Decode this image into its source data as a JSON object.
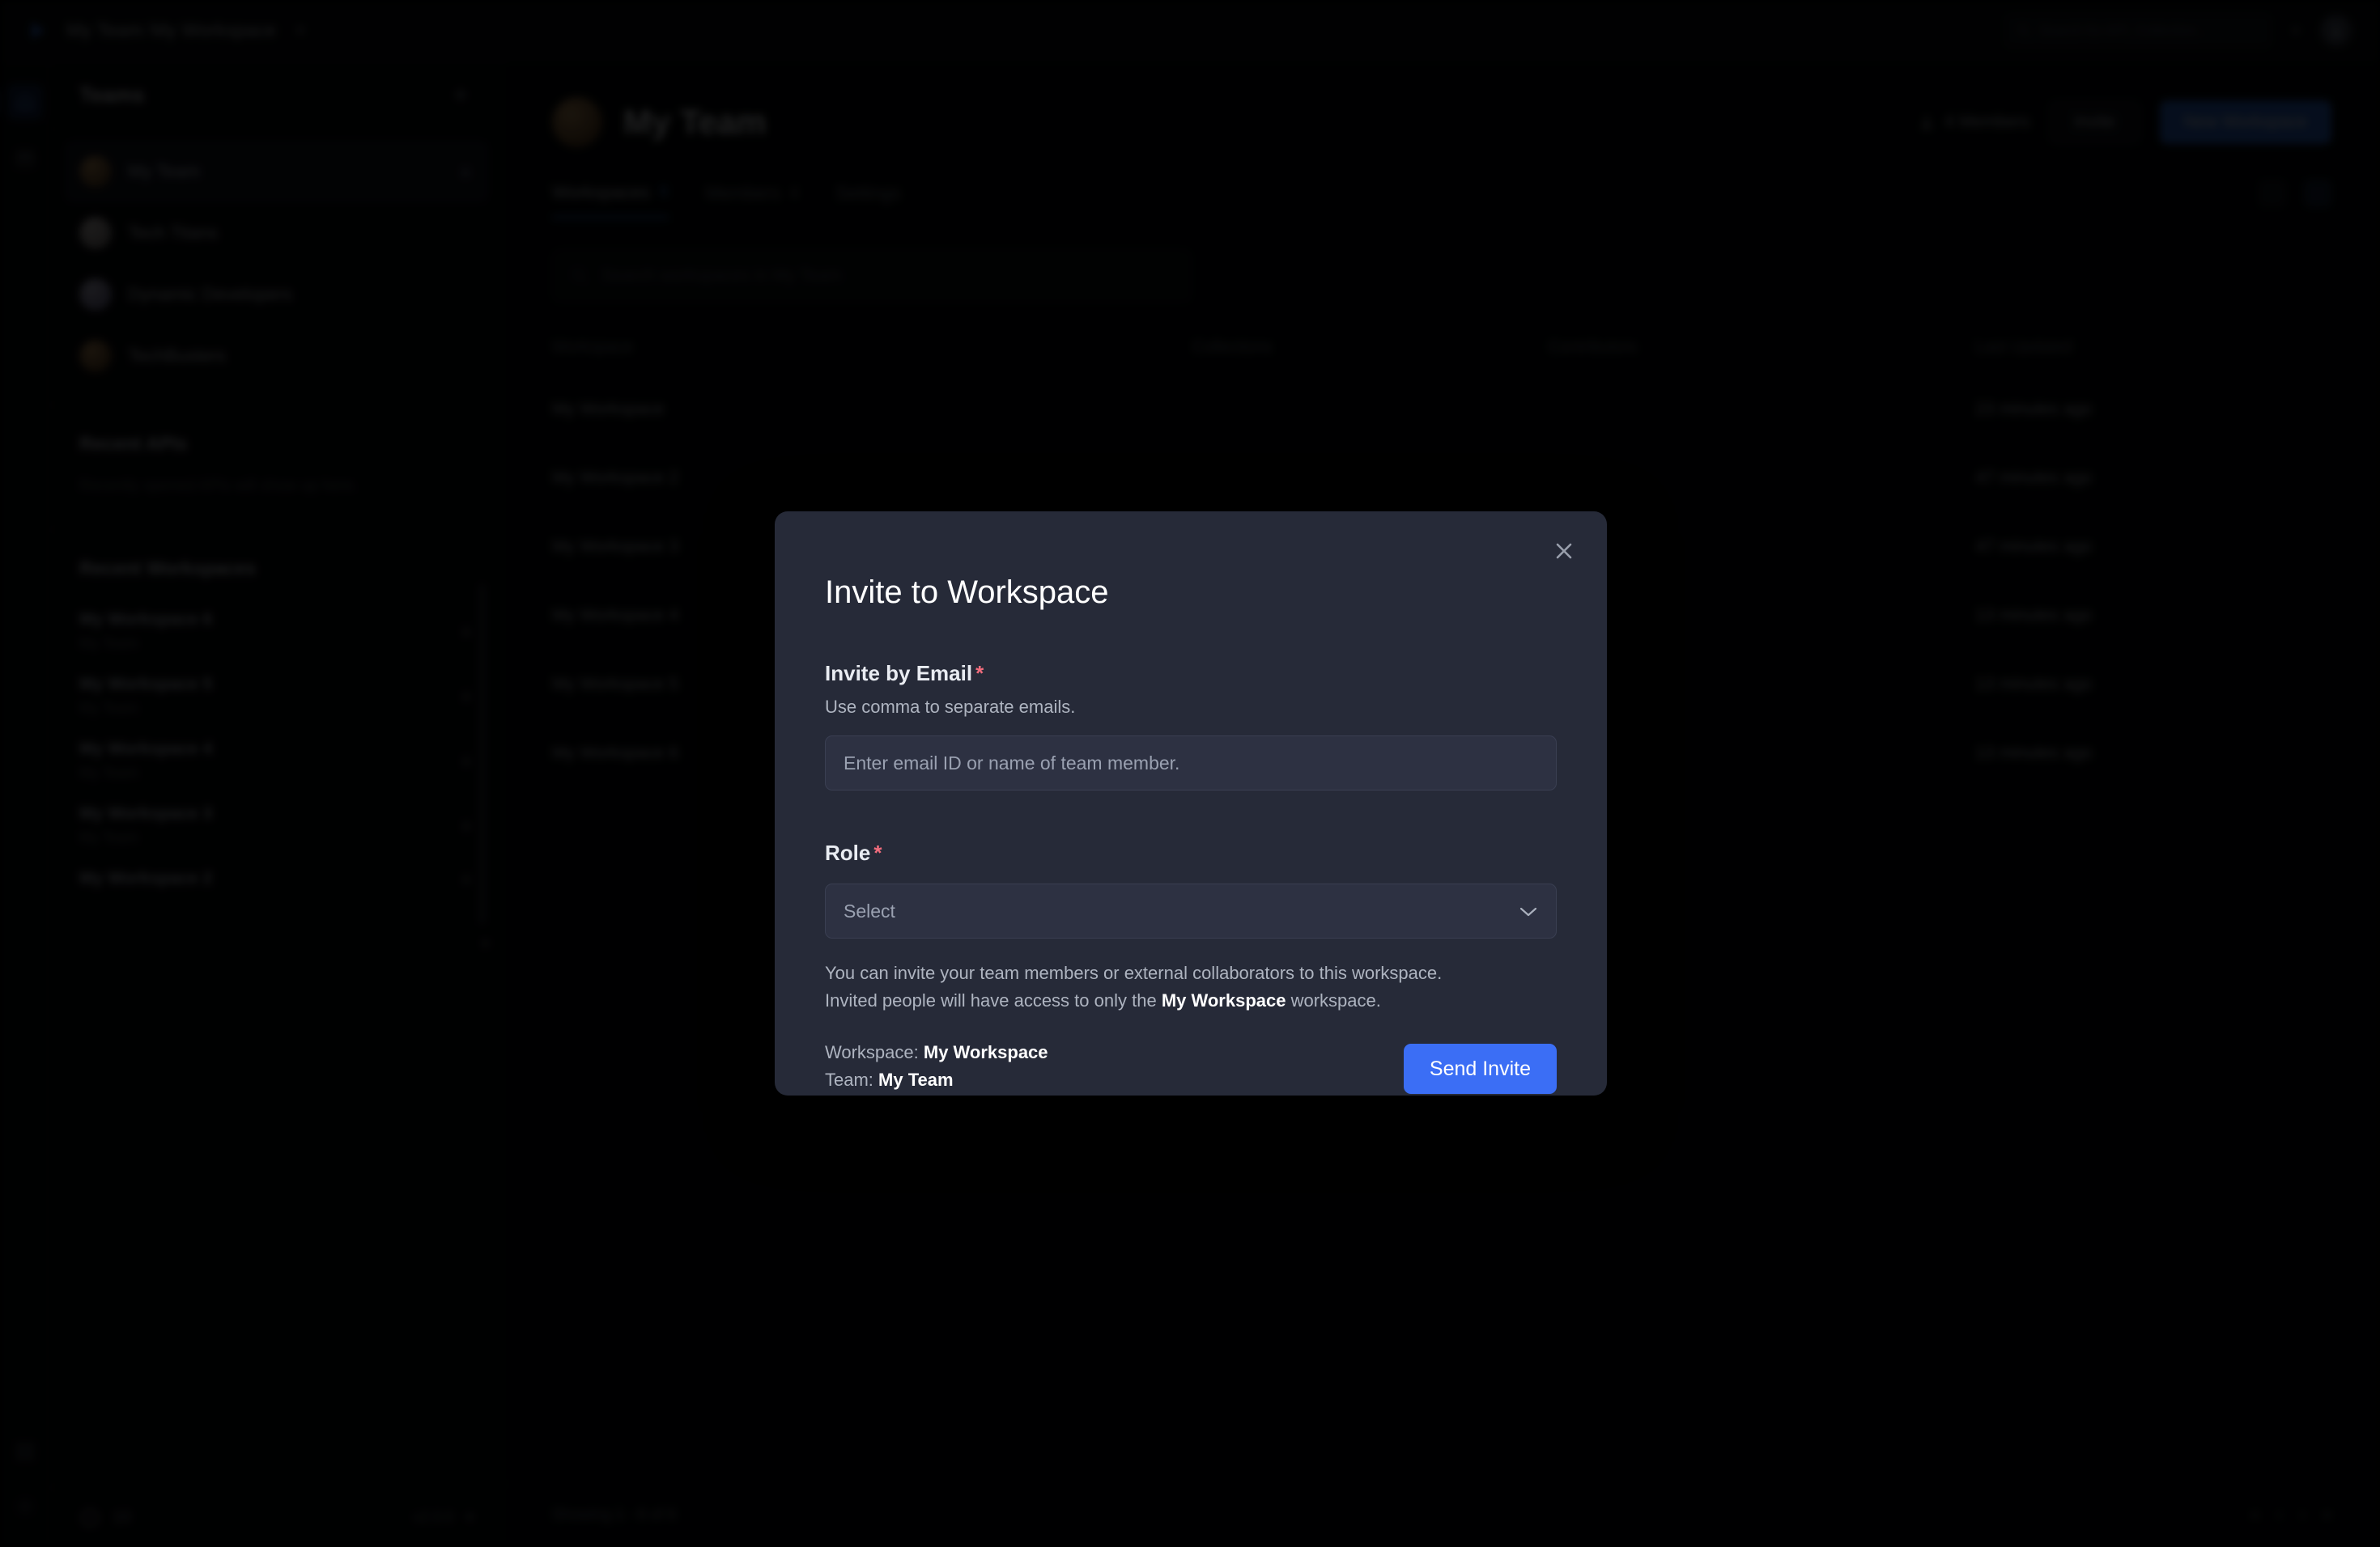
{
  "topbar": {
    "logo": "play-logo",
    "breadcrumb_team": "My Team",
    "breadcrumb_sep": "/",
    "breadcrumb_workspace": "My Workspace",
    "caret": "▾",
    "search_placeholder": "Search for API, Collection...",
    "chevron": "▾"
  },
  "rail": {
    "items": [
      {
        "name": "home-icon",
        "active": true
      },
      {
        "name": "collections-icon",
        "active": false
      }
    ],
    "bottom": [
      {
        "name": "apps-icon"
      },
      {
        "name": "settings-icon"
      }
    ]
  },
  "sidebar": {
    "title": "Teams",
    "add_label": "+",
    "teams": [
      {
        "label": "My Team",
        "avatar": "a",
        "active": true,
        "locked": true
      },
      {
        "label": "Tech Titans",
        "avatar": "b",
        "active": false,
        "locked": false
      },
      {
        "label": "Dynamic Developers",
        "avatar": "c",
        "active": false,
        "locked": false
      },
      {
        "label": "TechBusters",
        "avatar": "d",
        "active": false,
        "locked": false
      }
    ],
    "recent_apis": {
      "title": "Recent APIs",
      "empty_text": "Recently opened APIs will show up here."
    },
    "recent_workspaces": {
      "title": "Recent Workspaces",
      "items": [
        {
          "title": "My Workspace 6",
          "sub": "My Team"
        },
        {
          "title": "My Workspace 5",
          "sub": "My Team"
        },
        {
          "title": "My Workspace 4",
          "sub": "My Team"
        },
        {
          "title": "My Workspace 3",
          "sub": "My Team"
        },
        {
          "title": "My Workspace 2",
          "sub": "My Team"
        }
      ]
    },
    "footer": {
      "help_count": "10",
      "version": "v2.0.0"
    }
  },
  "main": {
    "team_name": "My Team",
    "members_label": "4 Members",
    "invite_label": "Invite",
    "new_workspace_label": "New Workspace",
    "tabs": [
      {
        "label": "Workspaces",
        "badge": "6",
        "active": true
      },
      {
        "label": "Members",
        "badge": "4",
        "active": false
      },
      {
        "label": "Settings",
        "badge": "",
        "active": false
      }
    ],
    "search_placeholder": "Search workspaces in My Team",
    "table": {
      "headers": [
        "Workspace",
        "Collections",
        "Contributors",
        "Last Updated"
      ],
      "rows": [
        {
          "workspace": "My Workspace",
          "collections": "",
          "contributors": "",
          "updated": "23 minutes ago"
        },
        {
          "workspace": "My Workspace 2",
          "collections": "",
          "contributors": "",
          "updated": "47 minutes ago"
        },
        {
          "workspace": "My Workspace 3",
          "collections": "",
          "contributors": "",
          "updated": "47 minutes ago"
        },
        {
          "workspace": "My Workspace 4",
          "collections": "",
          "contributors": "",
          "updated": "13 minutes ago"
        },
        {
          "workspace": "My Workspace 5",
          "collections": "",
          "contributors": "",
          "updated": "13 minutes ago"
        },
        {
          "workspace": "My Workspace 6",
          "collections": "",
          "contributors": "",
          "updated": "13 minutes ago"
        }
      ]
    },
    "pager": {
      "showing": "Showing 1 - 6 of 6",
      "first": "«",
      "prev": "‹",
      "next": "›",
      "last": "»"
    }
  },
  "modal": {
    "title": "Invite to Workspace",
    "close_label": "✕",
    "email": {
      "label": "Invite by Email",
      "required": "*",
      "hint": "Use comma to separate emails.",
      "placeholder": "Enter email ID or name of team member.",
      "value": ""
    },
    "role": {
      "label": "Role",
      "required": "*",
      "selected": "Select",
      "chevron": "⌄"
    },
    "note_line1": "You can invite your team members or external collaborators to this workspace.",
    "note_line2_pre": "Invited people will have access to only the ",
    "note_line2_strong": "My Workspace",
    "note_line2_post": " workspace.",
    "workspace_label": "Workspace",
    "workspace_value": "My Workspace",
    "team_label": "Team",
    "team_value": "My Team",
    "send_label": "Send Invite"
  },
  "colors": {
    "accent_blue": "#3b6ef5",
    "primary_blue": "#2e6bd6",
    "modal_bg": "#262a38",
    "input_bg": "#2d3142",
    "required_red": "#f26d7d",
    "page_bg": "#000000"
  }
}
